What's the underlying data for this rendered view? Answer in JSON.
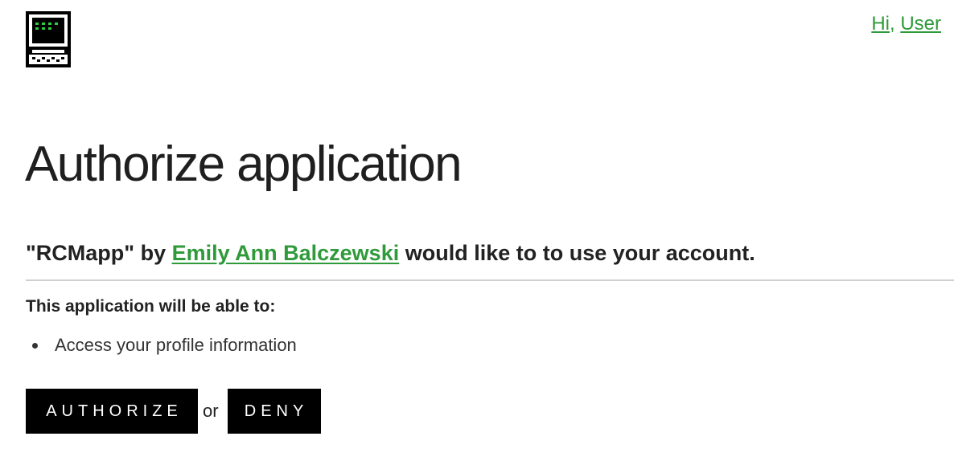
{
  "header": {
    "logo_icon": "retro-computer-icon",
    "greeting_hi": "Hi",
    "greeting_separator": ", ",
    "greeting_user": "User"
  },
  "main": {
    "title": "Authorize application",
    "request": {
      "app_name": "\"RCMapp\"",
      "by": " by ",
      "author": "Emily Ann Balczewski",
      "suffix": " would like to to use your account."
    },
    "permissions_heading": "This application will be able to:",
    "permissions": [
      "Access your profile information"
    ],
    "actions": {
      "authorize_label": "AUTHORIZE",
      "or_label": "or",
      "deny_label": "DENY"
    }
  },
  "colors": {
    "link": "#2f9a3a",
    "button_bg": "#000000",
    "button_text": "#ffffff",
    "divider": "#d0d0d0"
  }
}
